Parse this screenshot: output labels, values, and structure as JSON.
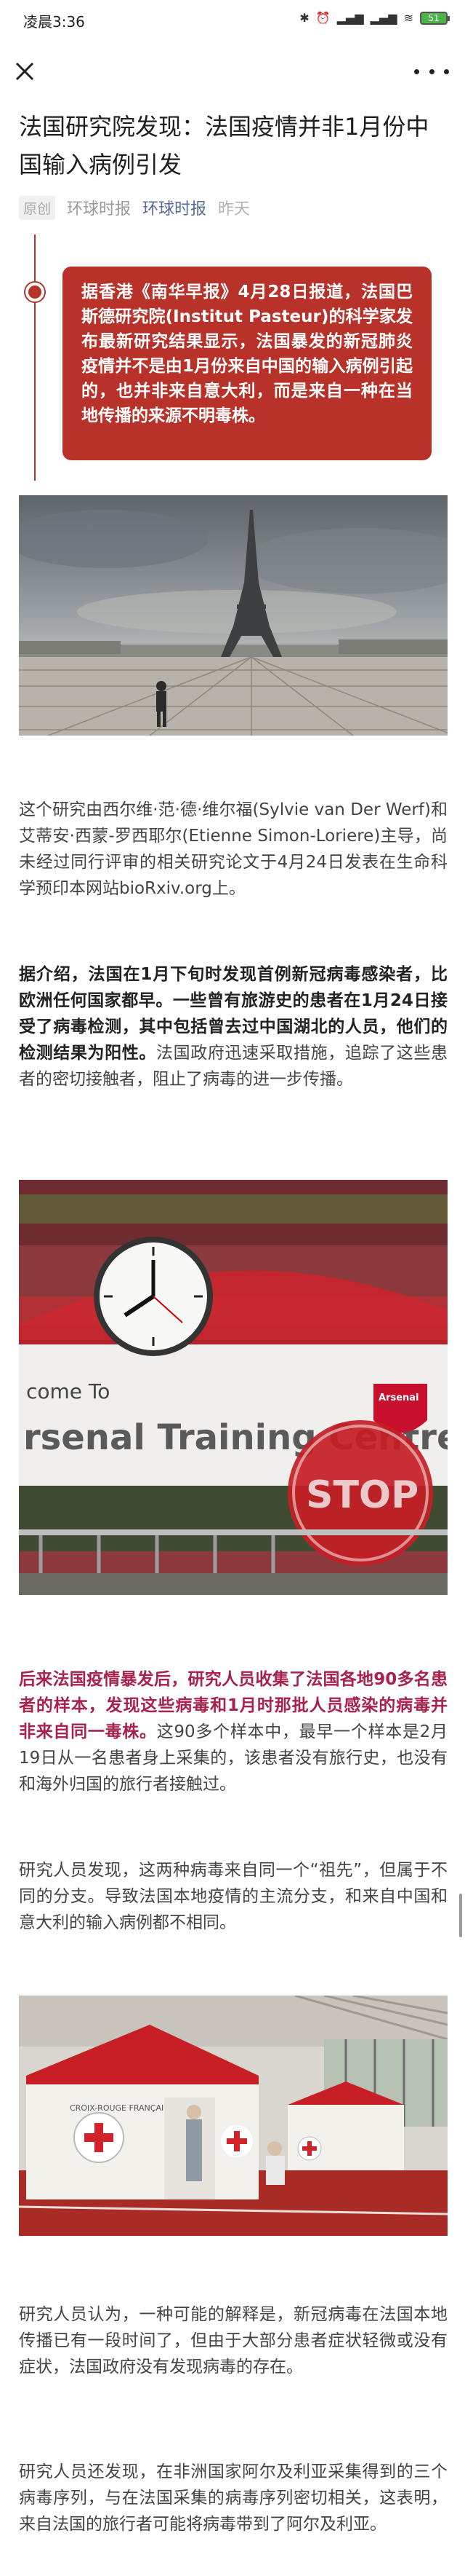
{
  "status": {
    "time": "凌晨3:36",
    "icons": [
      "bluetooth-icon",
      "alarm-icon",
      "signal-icon",
      "signal-icon",
      "wifi-icon"
    ],
    "battery": "51"
  },
  "article": {
    "title": "法国研究院发现：法国疫情并非1月份中国输入病例引发",
    "tag": "原创",
    "source": "环球时报",
    "account": "环球时报",
    "date": "昨天",
    "highlight": "据香港《南华早报》4月28日报道，法国巴斯德研究院(Institut Pasteur)的科学家发布最新研究结果显示，法国暴发的新冠肺炎疫情并不是由1月份来自中国的输入病例引起的，也并非来自意大利，而是来自一种在当地传播的来源不明毒株。",
    "p1": "这个研究由西尔维·范·德·维尔福(Sylvie van Der Werf)和艾蒂安·西蒙-罗西耶尔(Etienne Simon-Loriere)主导，尚未经过同行评审的相关研究论文于4月24日发表在生命科学预印本网站bioRxiv.org上。",
    "p2_bold": "据介绍，法国在1月下旬时发现首例新冠病毒感染者，比欧洲任何国家都早。一些曾有旅游史的患者在1月24日接受了病毒检测，其中包括曾去过中国湖北的人员，他们的检测结果为阳性。",
    "p2_rest": "法国政府迅速采取措施，追踪了这些患者的密切接触者，阻止了病毒的进一步传播。",
    "p3_red": "后来法国疫情暴发后，研究人员收集了法国各地90多名患者的样本，发现这些病毒和1月时那批人员感染的病毒并非来自同一毒株。",
    "p3_rest": "这90多个样本中，最早一个样本是2月19日从一名患者身上采集的，该患者没有旅行史，也没有和海外归国的旅行者接触过。",
    "p4": "研究人员发现，这两种病毒来自同一个“祖先”，但属于不同的分支。导致法国本地疫情的主流分支，和来自中国和意大利的输入病例都不相同。",
    "p5": "研究人员认为，一种可能的解释是，新冠病毒在法国本地传播已有一段时间了，但由于大部分患者症状轻微或没有症状，法国政府没有发现病毒的存在。",
    "p6": "研究人员还发现，在非洲国家阿尔及利亚采集得到的三个病毒序列，与在法国采集的病毒序列密切相关，这表明，来自法国的旅行者可能将病毒带到了阿尔及利亚。"
  },
  "images": {
    "img2_signs": {
      "welcome": "come To",
      "centre": "rsenal Training Centre",
      "stop": "STOP",
      "crest": "Arsenal"
    },
    "img3_tent": {
      "text": "CROIX-ROUGE FRANÇAISE"
    }
  },
  "colors": {
    "accent": "#b8322a",
    "link": "#576b95",
    "emphasis": "#a8224a"
  }
}
